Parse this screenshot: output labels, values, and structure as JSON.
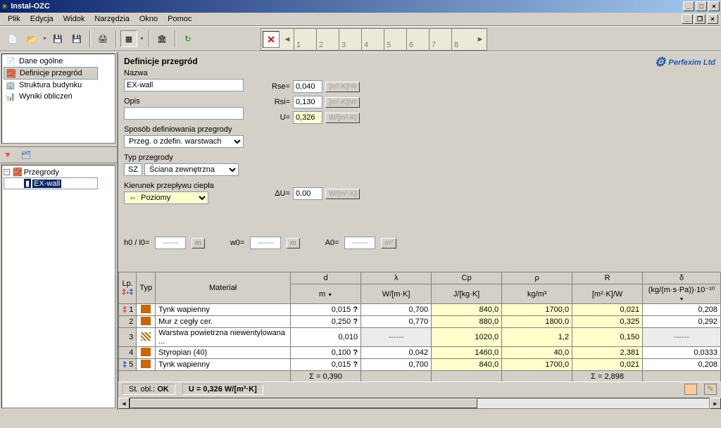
{
  "window": {
    "title": "Instal-OZC"
  },
  "menu": {
    "file": "Plik",
    "edit": "Edycja",
    "view": "Widok",
    "tools": "Narzędzia",
    "window": "Okno",
    "help": "Pomoc"
  },
  "tabs": {
    "t1": "1",
    "t2": "2",
    "t3": "3",
    "t4": "4",
    "t5": "5",
    "t6": "6",
    "t7": "7",
    "t8": "8"
  },
  "nav": {
    "general": "Dane ogólne",
    "partitions": "Definicje przegród",
    "structure": "Struktura budynku",
    "results": "Wyniki obliczeń",
    "tree_root": "Przegrody",
    "tree_item": "EX-wall"
  },
  "logo": "Perfexim Ltd",
  "form": {
    "title": "Definicje przegród",
    "name_lbl": "Nazwa",
    "name_val": "EX-wall",
    "desc_lbl": "Opis",
    "desc_val": "",
    "def_lbl": "Sposób definiowania przegrody",
    "def_val": "Przeg. o zdefin. warstwach",
    "type_lbl": "Typ przegrody",
    "type_code": "SZ",
    "type_val": "Ściana zewnętrzna",
    "dir_lbl": "Kierunek przepływu ciepła",
    "dir_val": "Poziomy",
    "rse_lbl": "Rse=",
    "rse_val": "0,040",
    "rse_unit": "[m²·K]/W",
    "rsi_lbl": "Rsi=",
    "rsi_val": "0,130",
    "rsi_unit": "[m²·K]/W",
    "u_lbl": "U=",
    "u_val": "0,326",
    "u_unit": "W/[m²·K]",
    "du_lbl": "ΔU=",
    "du_val": "0,00",
    "du_unit": "W/[m²·K]",
    "h_lbl": "h0 / l0=",
    "h_val": "------",
    "h_unit": "m",
    "w_lbl": "w0=",
    "w_val": "------",
    "w_unit": "m",
    "a_lbl": "A0=",
    "a_val": "------",
    "a_unit": "m²"
  },
  "grid": {
    "h_lp": "Lp.",
    "h_typ": "Typ",
    "h_mat": "Materiał",
    "h_d": "d",
    "h_lam": "λ",
    "h_cp": "Cp",
    "h_rho": "ρ",
    "h_r": "R",
    "h_del": "δ",
    "u_d": "m",
    "u_lam": "W/[m·K]",
    "u_cp": "J/[kg·K]",
    "u_rho": "kg/m³",
    "u_r": "[m²·K]/W",
    "u_del": "(kg/(m·s·Pa))·10⁻¹⁰",
    "sum_d": "Σ = 0,390",
    "sum_r": "Σ = 2,898",
    "rows": [
      {
        "n": "1",
        "mat": "Tynk wapienny",
        "d": "0,015",
        "lam": "0,700",
        "cp": "840,0",
        "rho": "1700,0",
        "r": "0,021",
        "del": "0,208",
        "q": "?"
      },
      {
        "n": "2",
        "mat": "Mur z cegły cer.",
        "d": "0,250",
        "lam": "0,770",
        "cp": "880,0",
        "rho": "1800,0",
        "r": "0,325",
        "del": "0,292",
        "q": "?"
      },
      {
        "n": "3",
        "mat": "Warstwa powietrzna niewentylowana ...",
        "d": "0,010",
        "lam": "------",
        "cp": "1020,0",
        "rho": "1,2",
        "r": "0,150",
        "del": "------"
      },
      {
        "n": "4",
        "mat": "Styropian (40)",
        "d": "0,100",
        "lam": "0,042",
        "cp": "1460,0",
        "rho": "40,0",
        "r": "2,381",
        "del": "0,0333",
        "q": "?"
      },
      {
        "n": "5",
        "mat": "Tynk wapienny",
        "d": "0,015",
        "lam": "0,700",
        "cp": "840,0",
        "rho": "1700,0",
        "r": "0,021",
        "del": "0,208",
        "q": "?"
      }
    ]
  },
  "status": {
    "calc_lbl": "St. obl.:",
    "calc_val": "OK",
    "u_text": "U = 0,326 W/[m²·K]"
  }
}
